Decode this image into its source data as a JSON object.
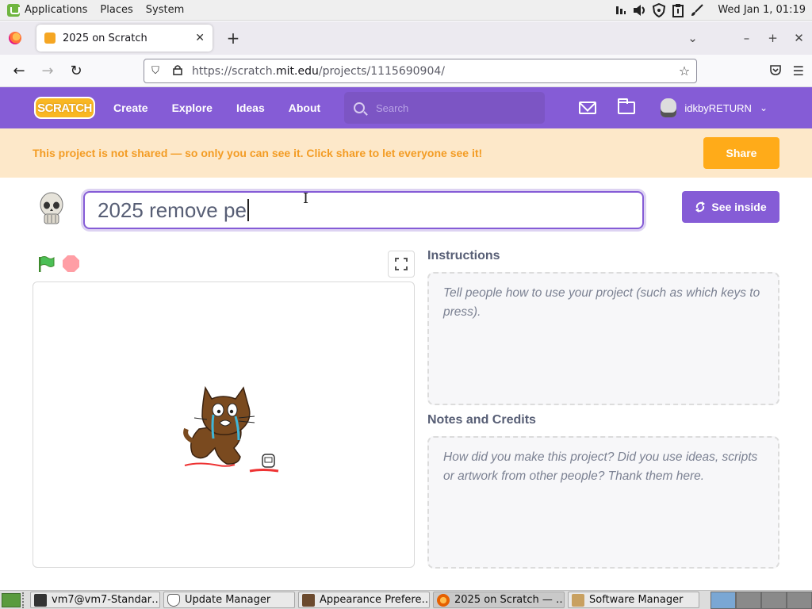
{
  "os_panel": {
    "menus": [
      "Applications",
      "Places",
      "System"
    ],
    "clock": "Wed Jan  1, 01:19",
    "tray_icons": [
      "network-icon",
      "volume-icon",
      "shield-icon",
      "clipboard-icon",
      "brush-icon"
    ]
  },
  "browser": {
    "tab_title": "2025 on Scratch",
    "url_prefix": "https://scratch.",
    "url_domain": "mit.edu",
    "url_path": "/projects/1115690904/"
  },
  "scratch_header": {
    "logo": "SCRATCH",
    "nav": [
      "Create",
      "Explore",
      "Ideas",
      "About"
    ],
    "search_placeholder": "Search",
    "username": "idkbyRETURN"
  },
  "banner": {
    "message": "This project is not shared — so only you can see it. Click share to let everyone see it!",
    "share_label": "Share"
  },
  "project": {
    "title_value": "2025 remove pe",
    "see_inside_label": "See inside"
  },
  "instructions": {
    "heading": "Instructions",
    "placeholder": "Tell people how to use your project (such as which keys to press)."
  },
  "notes": {
    "heading": "Notes and Credits",
    "placeholder": "How did you make this project? Did you use ideas, scripts or artwork from other people? Thank them here."
  },
  "taskbar": {
    "items": [
      {
        "label": "vm7@vm7-Standar…",
        "icon": "terminal-icon",
        "color": "#333333"
      },
      {
        "label": "Update Manager",
        "icon": "shield-icon",
        "color": "#ffffff"
      },
      {
        "label": "Appearance Prefere…",
        "icon": "appearance-icon",
        "color": "#6b4a2e"
      },
      {
        "label": "2025 on Scratch — …",
        "icon": "firefox-icon",
        "color": "#e66000"
      },
      {
        "label": "Software Manager",
        "icon": "software-manager-icon",
        "color": "#c8a060"
      }
    ]
  },
  "colors": {
    "scratch_purple": "#855cd6",
    "banner_bg": "#fde8c9",
    "share_orange": "#ffab19"
  }
}
